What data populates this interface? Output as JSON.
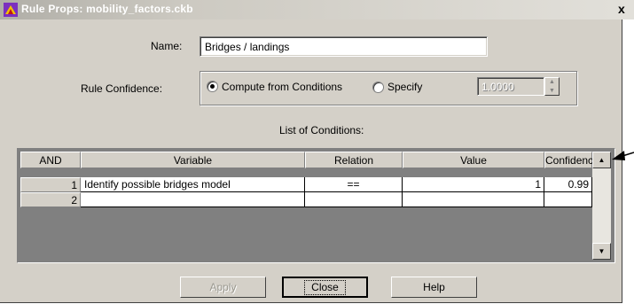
{
  "window": {
    "title": "Rule Props: mobility_factors.ckb",
    "close_glyph": "x"
  },
  "form": {
    "name_label": "Name:",
    "name_value": "Bridges / landings",
    "confidence_label": "Rule Confidence:",
    "compute_option": "Compute from Conditions",
    "specify_option": "Specify",
    "specify_value": "1.0000",
    "compute_selected": true
  },
  "conditions": {
    "label": "List of Conditions:",
    "columns": [
      "AND",
      "Variable",
      "Relation",
      "Value",
      "Confidence"
    ],
    "rows": [
      {
        "num": "1",
        "variable": "Identify possible bridges model",
        "relation": "==",
        "value": "1",
        "confidence": "0.99"
      },
      {
        "num": "2",
        "variable": "",
        "relation": "",
        "value": "",
        "confidence": ""
      }
    ]
  },
  "buttons": {
    "apply": "Apply",
    "close": "Close",
    "help": "Help"
  },
  "icons": {
    "app": "rule-app-icon",
    "scroll_up": "scroll-up-icon",
    "scroll_down": "scroll-down-icon",
    "callout": "callout-arrow-icon"
  }
}
